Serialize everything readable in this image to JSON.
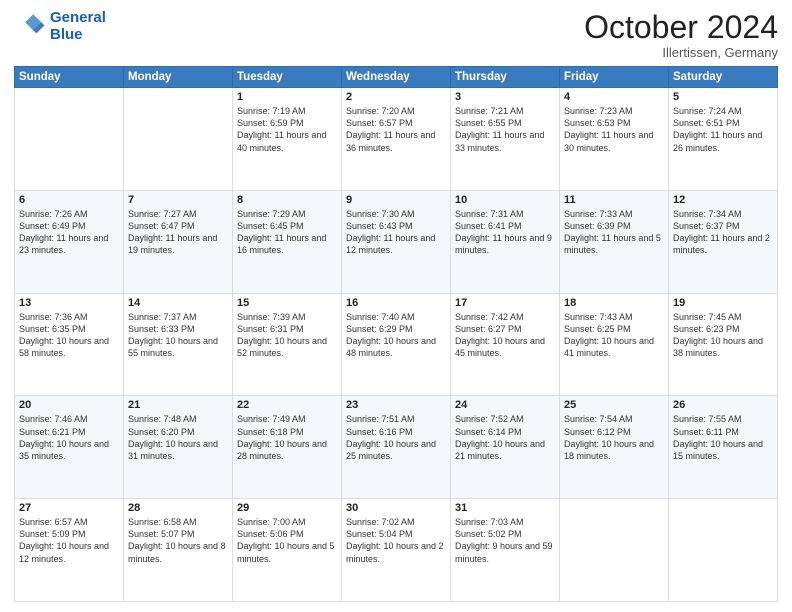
{
  "header": {
    "logo_line1": "General",
    "logo_line2": "Blue",
    "month": "October 2024",
    "location": "Illertissen, Germany"
  },
  "days_of_week": [
    "Sunday",
    "Monday",
    "Tuesday",
    "Wednesday",
    "Thursday",
    "Friday",
    "Saturday"
  ],
  "weeks": [
    [
      {
        "day": "",
        "info": ""
      },
      {
        "day": "",
        "info": ""
      },
      {
        "day": "1",
        "info": "Sunrise: 7:19 AM\nSunset: 6:59 PM\nDaylight: 11 hours and 40 minutes."
      },
      {
        "day": "2",
        "info": "Sunrise: 7:20 AM\nSunset: 6:57 PM\nDaylight: 11 hours and 36 minutes."
      },
      {
        "day": "3",
        "info": "Sunrise: 7:21 AM\nSunset: 6:55 PM\nDaylight: 11 hours and 33 minutes."
      },
      {
        "day": "4",
        "info": "Sunrise: 7:23 AM\nSunset: 6:53 PM\nDaylight: 11 hours and 30 minutes."
      },
      {
        "day": "5",
        "info": "Sunrise: 7:24 AM\nSunset: 6:51 PM\nDaylight: 11 hours and 26 minutes."
      }
    ],
    [
      {
        "day": "6",
        "info": "Sunrise: 7:26 AM\nSunset: 6:49 PM\nDaylight: 11 hours and 23 minutes."
      },
      {
        "day": "7",
        "info": "Sunrise: 7:27 AM\nSunset: 6:47 PM\nDaylight: 11 hours and 19 minutes."
      },
      {
        "day": "8",
        "info": "Sunrise: 7:29 AM\nSunset: 6:45 PM\nDaylight: 11 hours and 16 minutes."
      },
      {
        "day": "9",
        "info": "Sunrise: 7:30 AM\nSunset: 6:43 PM\nDaylight: 11 hours and 12 minutes."
      },
      {
        "day": "10",
        "info": "Sunrise: 7:31 AM\nSunset: 6:41 PM\nDaylight: 11 hours and 9 minutes."
      },
      {
        "day": "11",
        "info": "Sunrise: 7:33 AM\nSunset: 6:39 PM\nDaylight: 11 hours and 5 minutes."
      },
      {
        "day": "12",
        "info": "Sunrise: 7:34 AM\nSunset: 6:37 PM\nDaylight: 11 hours and 2 minutes."
      }
    ],
    [
      {
        "day": "13",
        "info": "Sunrise: 7:36 AM\nSunset: 6:35 PM\nDaylight: 10 hours and 58 minutes."
      },
      {
        "day": "14",
        "info": "Sunrise: 7:37 AM\nSunset: 6:33 PM\nDaylight: 10 hours and 55 minutes."
      },
      {
        "day": "15",
        "info": "Sunrise: 7:39 AM\nSunset: 6:31 PM\nDaylight: 10 hours and 52 minutes."
      },
      {
        "day": "16",
        "info": "Sunrise: 7:40 AM\nSunset: 6:29 PM\nDaylight: 10 hours and 48 minutes."
      },
      {
        "day": "17",
        "info": "Sunrise: 7:42 AM\nSunset: 6:27 PM\nDaylight: 10 hours and 45 minutes."
      },
      {
        "day": "18",
        "info": "Sunrise: 7:43 AM\nSunset: 6:25 PM\nDaylight: 10 hours and 41 minutes."
      },
      {
        "day": "19",
        "info": "Sunrise: 7:45 AM\nSunset: 6:23 PM\nDaylight: 10 hours and 38 minutes."
      }
    ],
    [
      {
        "day": "20",
        "info": "Sunrise: 7:46 AM\nSunset: 6:21 PM\nDaylight: 10 hours and 35 minutes."
      },
      {
        "day": "21",
        "info": "Sunrise: 7:48 AM\nSunset: 6:20 PM\nDaylight: 10 hours and 31 minutes."
      },
      {
        "day": "22",
        "info": "Sunrise: 7:49 AM\nSunset: 6:18 PM\nDaylight: 10 hours and 28 minutes."
      },
      {
        "day": "23",
        "info": "Sunrise: 7:51 AM\nSunset: 6:16 PM\nDaylight: 10 hours and 25 minutes."
      },
      {
        "day": "24",
        "info": "Sunrise: 7:52 AM\nSunset: 6:14 PM\nDaylight: 10 hours and 21 minutes."
      },
      {
        "day": "25",
        "info": "Sunrise: 7:54 AM\nSunset: 6:12 PM\nDaylight: 10 hours and 18 minutes."
      },
      {
        "day": "26",
        "info": "Sunrise: 7:55 AM\nSunset: 6:11 PM\nDaylight: 10 hours and 15 minutes."
      }
    ],
    [
      {
        "day": "27",
        "info": "Sunrise: 6:57 AM\nSunset: 5:09 PM\nDaylight: 10 hours and 12 minutes."
      },
      {
        "day": "28",
        "info": "Sunrise: 6:58 AM\nSunset: 5:07 PM\nDaylight: 10 hours and 8 minutes."
      },
      {
        "day": "29",
        "info": "Sunrise: 7:00 AM\nSunset: 5:06 PM\nDaylight: 10 hours and 5 minutes."
      },
      {
        "day": "30",
        "info": "Sunrise: 7:02 AM\nSunset: 5:04 PM\nDaylight: 10 hours and 2 minutes."
      },
      {
        "day": "31",
        "info": "Sunrise: 7:03 AM\nSunset: 5:02 PM\nDaylight: 9 hours and 59 minutes."
      },
      {
        "day": "",
        "info": ""
      },
      {
        "day": "",
        "info": ""
      }
    ]
  ]
}
